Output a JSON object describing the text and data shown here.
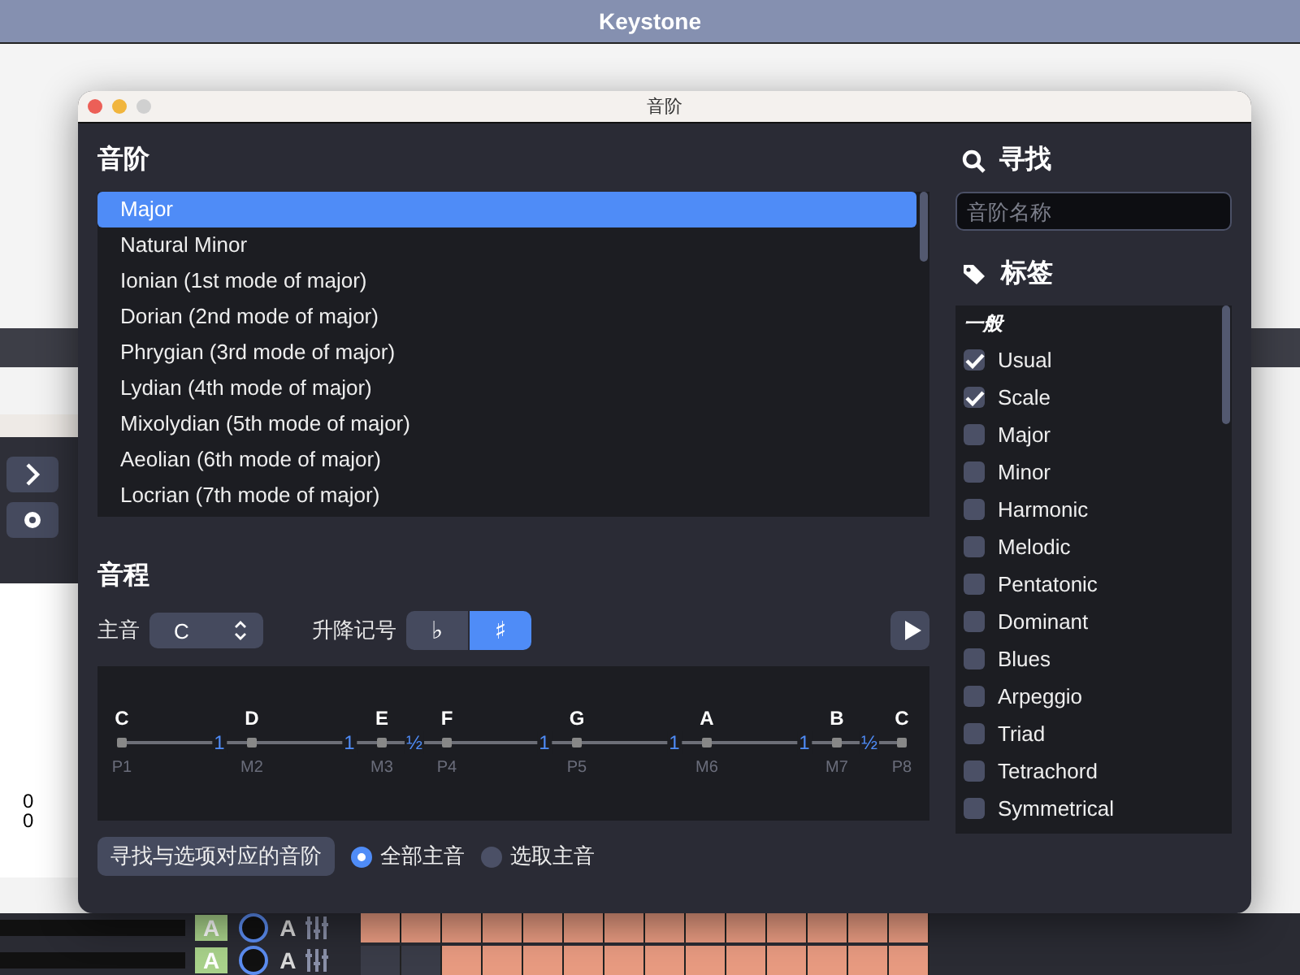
{
  "app_title": "Keystone",
  "background": {
    "tab_numbers": [
      "0",
      "0"
    ],
    "track_badges": [
      "A",
      "A",
      "A",
      "A"
    ]
  },
  "dialog": {
    "title": "音阶",
    "scales": {
      "heading": "音阶",
      "items": [
        {
          "label": "Major",
          "selected": true
        },
        {
          "label": "Natural Minor",
          "selected": false
        },
        {
          "label": "Ionian (1st mode of major)",
          "selected": false
        },
        {
          "label": "Dorian (2nd mode of major)",
          "selected": false
        },
        {
          "label": "Phrygian (3rd mode of major)",
          "selected": false
        },
        {
          "label": "Lydian (4th mode of major)",
          "selected": false
        },
        {
          "label": "Mixolydian (5th mode of major)",
          "selected": false
        },
        {
          "label": "Aeolian (6th mode of major)",
          "selected": false
        },
        {
          "label": "Locrian (7th mode of major)",
          "selected": false
        }
      ]
    },
    "intervals": {
      "heading": "音程",
      "tonic_label": "主音",
      "tonic_value": "C",
      "accidental_label": "升降记号",
      "accidentals": [
        {
          "symbol": "♭",
          "selected": false
        },
        {
          "symbol": "♯",
          "selected": true
        }
      ],
      "notes": [
        {
          "name": "C",
          "interval": "P1"
        },
        {
          "name": "D",
          "interval": "M2"
        },
        {
          "name": "E",
          "interval": "M3"
        },
        {
          "name": "F",
          "interval": "P4"
        },
        {
          "name": "G",
          "interval": "P5"
        },
        {
          "name": "A",
          "interval": "M6"
        },
        {
          "name": "B",
          "interval": "M7"
        },
        {
          "name": "C",
          "interval": "P8"
        }
      ],
      "steps": [
        {
          "label": "1",
          "kind": "whole"
        },
        {
          "label": "1",
          "kind": "whole"
        },
        {
          "label": "½",
          "kind": "half"
        },
        {
          "label": "1",
          "kind": "whole"
        },
        {
          "label": "1",
          "kind": "whole"
        },
        {
          "label": "1",
          "kind": "whole"
        },
        {
          "label": "½",
          "kind": "half"
        }
      ]
    },
    "find_button": "寻找与选项对应的音阶",
    "tonic_scope": [
      {
        "label": "全部主音",
        "selected": true
      },
      {
        "label": "选取主音",
        "selected": false
      }
    ],
    "search": {
      "heading": "寻找",
      "placeholder": "音阶名称"
    },
    "tags": {
      "heading": "标签",
      "group": "一般",
      "items": [
        {
          "label": "Usual",
          "checked": true
        },
        {
          "label": "Scale",
          "checked": true
        },
        {
          "label": "Major",
          "checked": false
        },
        {
          "label": "Minor",
          "checked": false
        },
        {
          "label": "Harmonic",
          "checked": false
        },
        {
          "label": "Melodic",
          "checked": false
        },
        {
          "label": "Pentatonic",
          "checked": false
        },
        {
          "label": "Dominant",
          "checked": false
        },
        {
          "label": "Blues",
          "checked": false
        },
        {
          "label": "Arpeggio",
          "checked": false
        },
        {
          "label": "Triad",
          "checked": false
        },
        {
          "label": "Tetrachord",
          "checked": false
        },
        {
          "label": "Symmetrical",
          "checked": false
        }
      ]
    }
  }
}
